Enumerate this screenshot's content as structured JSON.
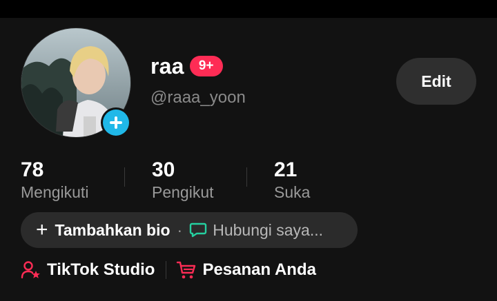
{
  "profile": {
    "display_name": "raa",
    "badge": "9+",
    "username": "@raaa_yoon",
    "edit_label": "Edit",
    "avatar_icon": "profile-photo",
    "add_photo_icon": "plus-icon",
    "accent_blue": "#20b8e8",
    "badge_color": "#fe2c55"
  },
  "stats": [
    {
      "value": "78",
      "label": "Mengikuti"
    },
    {
      "value": "30",
      "label": "Pengikut"
    },
    {
      "value": "21",
      "label": "Suka"
    }
  ],
  "bio": {
    "add_label": "Tambahkan bio",
    "separator": "·",
    "contact_label": "Hubungi saya...",
    "contact_icon": "chat-bubble-icon",
    "contact_icon_color": "#25d0a0"
  },
  "links": [
    {
      "label": "TikTok Studio",
      "icon": "user-star-icon",
      "icon_color": "#fe2c55"
    },
    {
      "label": "Pesanan Anda",
      "icon": "shopping-cart-icon",
      "icon_color": "#fe2c55"
    }
  ]
}
